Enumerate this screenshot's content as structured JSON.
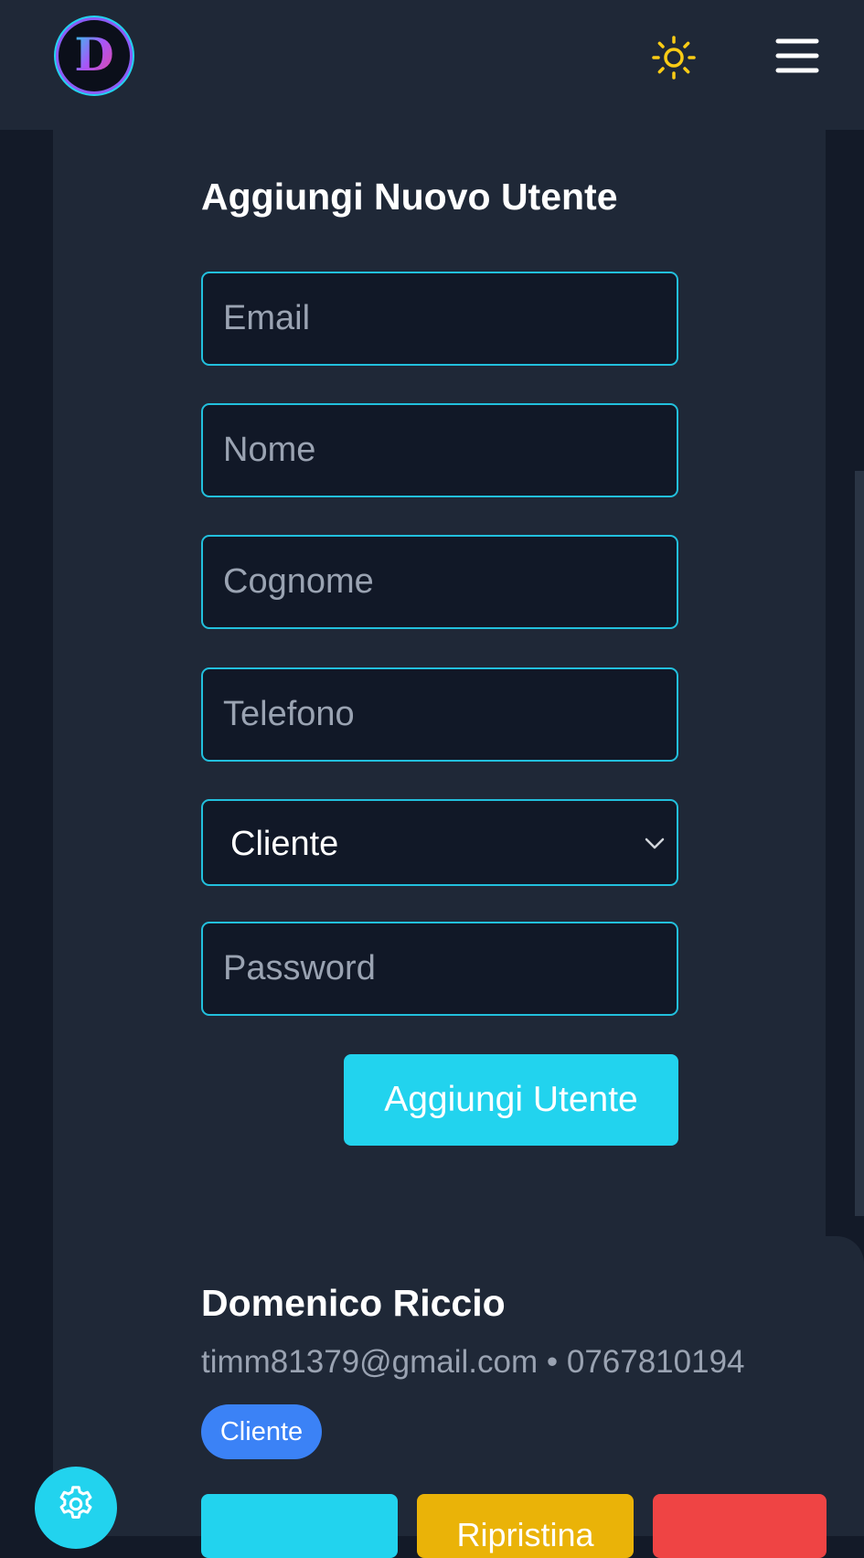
{
  "header": {
    "logo_letter": "D",
    "theme_icon": "sun-icon",
    "menu_icon": "hamburger-menu-icon"
  },
  "form": {
    "title": "Aggiungi Nuovo Utente",
    "email_placeholder": "Email",
    "name_placeholder": "Nome",
    "surname_placeholder": "Cognome",
    "phone_placeholder": "Telefono",
    "role_selected": "Cliente",
    "password_placeholder": "Password",
    "submit_label": "Aggiungi Utente"
  },
  "user": {
    "name": "Domenico Riccio",
    "contact": "timm81379@gmail.com • 0767810194",
    "role": "Cliente",
    "actions": {
      "edit_label": "",
      "reset_label": "Ripristina",
      "delete_label": ""
    }
  },
  "fab": {
    "icon": "gear-icon"
  },
  "colors": {
    "accent": "#22d3ee",
    "background": "#131a28",
    "panel": "#1f2837",
    "input_bg": "#111827",
    "badge": "#3b82f6",
    "warning": "#eab308",
    "danger": "#ef4444",
    "sun": "#facc15"
  }
}
